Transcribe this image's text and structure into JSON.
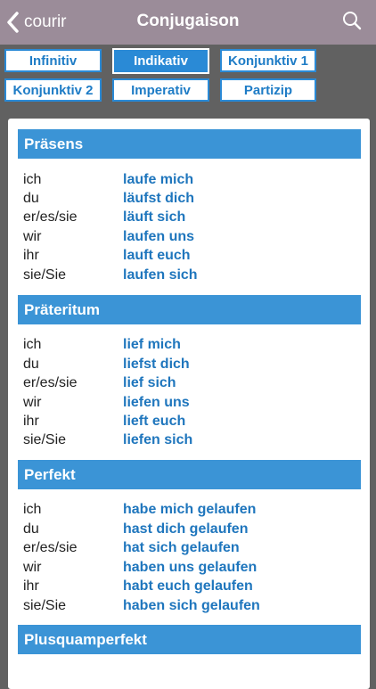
{
  "nav": {
    "back_label": "courir",
    "title": "Conjugaison"
  },
  "tabs": [
    "Infinitiv",
    "Indikativ",
    "Konjunktiv 1",
    "Konjunktiv 2",
    "Imperativ",
    "Partizip"
  ],
  "active_tab": "Indikativ",
  "sections": [
    {
      "title": "Präsens",
      "rows": [
        {
          "p": "ich",
          "v": "laufe mich"
        },
        {
          "p": "du",
          "v": "läufst dich"
        },
        {
          "p": "er/es/sie",
          "v": "läuft sich"
        },
        {
          "p": "wir",
          "v": "laufen uns"
        },
        {
          "p": "ihr",
          "v": "lauft euch"
        },
        {
          "p": "sie/Sie",
          "v": "laufen sich"
        }
      ]
    },
    {
      "title": "Präteritum",
      "rows": [
        {
          "p": "ich",
          "v": "lief mich"
        },
        {
          "p": "du",
          "v": "liefst dich"
        },
        {
          "p": "er/es/sie",
          "v": "lief sich"
        },
        {
          "p": "wir",
          "v": "liefen uns"
        },
        {
          "p": "ihr",
          "v": "lieft euch"
        },
        {
          "p": "sie/Sie",
          "v": "liefen sich"
        }
      ]
    },
    {
      "title": "Perfekt",
      "rows": [
        {
          "p": "ich",
          "v": "habe mich gelaufen"
        },
        {
          "p": "du",
          "v": "hast dich gelaufen"
        },
        {
          "p": "er/es/sie",
          "v": "hat sich gelaufen"
        },
        {
          "p": "wir",
          "v": "haben uns gelaufen"
        },
        {
          "p": "ihr",
          "v": "habt euch gelaufen"
        },
        {
          "p": "sie/Sie",
          "v": "haben sich gelaufen"
        }
      ]
    },
    {
      "title": "Plusquamperfekt",
      "rows": []
    }
  ]
}
